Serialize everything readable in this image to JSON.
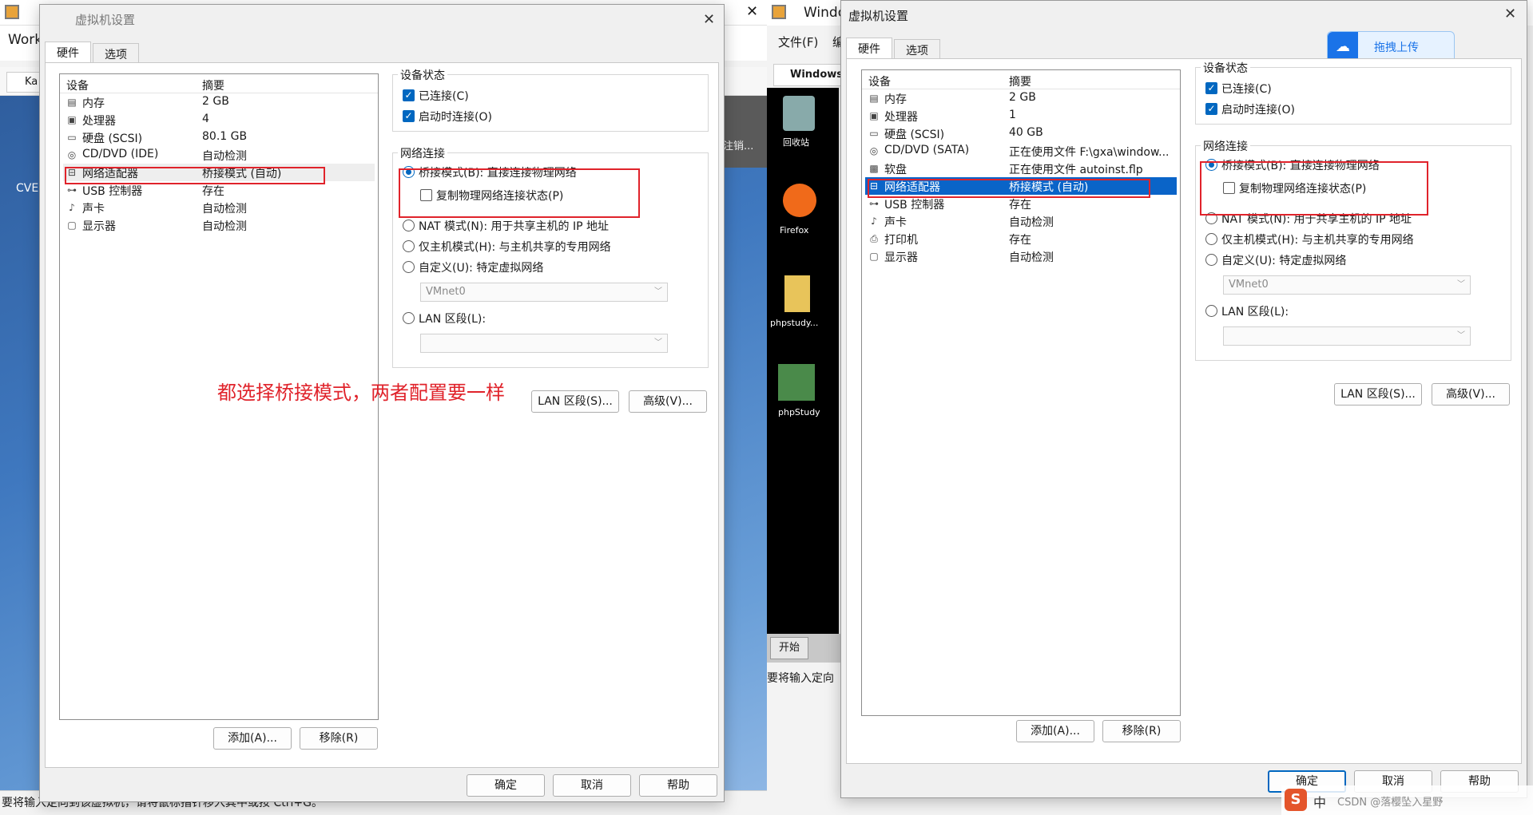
{
  "left_window": {
    "app_title_fragment": "Work",
    "tab_fragment": "Ka",
    "side_text": "CVE",
    "status_text": "要将输入定向到该虚拟机，请将鼠标指针移入其中或按 Ctrl+G。"
  },
  "right_window": {
    "app_title_fragment": "Windo",
    "menu_file": "文件(F)",
    "menu_fragment": "编",
    "tab_fragment": "Windows",
    "desktop_icons": [
      "回收站",
      "Firefox",
      "phpstudy...",
      "phpStudy"
    ],
    "start_button": "开始",
    "status_text": "要将输入定向"
  },
  "left_dialog": {
    "title": "虚拟机设置",
    "tabs": [
      "硬件",
      "选项"
    ],
    "columns": [
      "设备",
      "摘要"
    ],
    "devices": [
      {
        "icon": "memory-icon",
        "name": "内存",
        "summary": "2 GB"
      },
      {
        "icon": "cpu-icon",
        "name": "处理器",
        "summary": "4"
      },
      {
        "icon": "disk-icon",
        "name": "硬盘 (SCSI)",
        "summary": "80.1 GB"
      },
      {
        "icon": "cdrom-icon",
        "name": "CD/DVD (IDE)",
        "summary": "自动检测"
      },
      {
        "icon": "network-icon",
        "name": "网络适配器",
        "summary": "桥接模式 (自动)"
      },
      {
        "icon": "usb-icon",
        "name": "USB 控制器",
        "summary": "存在"
      },
      {
        "icon": "sound-icon",
        "name": "声卡",
        "summary": "自动检测"
      },
      {
        "icon": "display-icon",
        "name": "显示器",
        "summary": "自动检测"
      }
    ],
    "device_status": {
      "label": "设备状态",
      "connected": "已连接(C)",
      "connect_on_power": "启动时连接(O)"
    },
    "network": {
      "label": "网络连接",
      "bridged": "桥接模式(B): 直接连接物理网络",
      "replicate": "复制物理网络连接状态(P)",
      "nat": "NAT 模式(N): 用于共享主机的 IP 地址",
      "host_only": "仅主机模式(H): 与主机共享的专用网络",
      "custom": "自定义(U): 特定虚拟网络",
      "custom_value": "VMnet0",
      "lan": "LAN 区段(L):",
      "lan_value": ""
    },
    "buttons": {
      "lan_segments": "LAN 区段(S)...",
      "advanced": "高级(V)...",
      "add": "添加(A)...",
      "remove": "移除(R)",
      "ok": "确定",
      "cancel": "取消",
      "help": "帮助"
    }
  },
  "right_dialog": {
    "title": "虚拟机设置",
    "tabs": [
      "硬件",
      "选项"
    ],
    "columns": [
      "设备",
      "摘要"
    ],
    "devices": [
      {
        "icon": "memory-icon",
        "name": "内存",
        "summary": "2 GB"
      },
      {
        "icon": "cpu-icon",
        "name": "处理器",
        "summary": "1"
      },
      {
        "icon": "disk-icon",
        "name": "硬盘 (SCSI)",
        "summary": "40 GB"
      },
      {
        "icon": "cdrom-icon",
        "name": "CD/DVD (SATA)",
        "summary": "正在使用文件 F:\\gxa\\window..."
      },
      {
        "icon": "floppy-icon",
        "name": "软盘",
        "summary": "正在使用文件 autoinst.flp"
      },
      {
        "icon": "network-icon",
        "name": "网络适配器",
        "summary": "桥接模式 (自动)"
      },
      {
        "icon": "usb-icon",
        "name": "USB 控制器",
        "summary": "存在"
      },
      {
        "icon": "sound-icon",
        "name": "声卡",
        "summary": "自动检测"
      },
      {
        "icon": "printer-icon",
        "name": "打印机",
        "summary": "存在"
      },
      {
        "icon": "display-icon",
        "name": "显示器",
        "summary": "自动检测"
      }
    ],
    "device_status": {
      "label": "设备状态",
      "connected": "已连接(C)",
      "connect_on_power": "启动时连接(O)"
    },
    "network": {
      "label": "网络连接",
      "bridged": "桥接模式(B): 直接连接物理网络",
      "replicate": "复制物理网络连接状态(P)",
      "nat": "NAT 模式(N): 用于共享主机的 IP 地址",
      "host_only": "仅主机模式(H): 与主机共享的专用网络",
      "custom": "自定义(U): 特定虚拟网络",
      "custom_value": "VMnet0",
      "lan": "LAN 区段(L):",
      "lan_value": ""
    },
    "buttons": {
      "lan_segments": "LAN 区段(S)...",
      "advanced": "高级(V)...",
      "add": "添加(A)...",
      "remove": "移除(R)",
      "ok": "确定",
      "cancel": "取消",
      "help": "帮助"
    }
  },
  "upload_badge": "拖拽上传",
  "annotation": "都选择桥接模式，两者配置要一样",
  "watermark": "CSDN @落樱坠入星野",
  "ime": "中",
  "colors": {
    "accent": "#0067c0",
    "selection": "#0a64c8",
    "annotation_red": "#e0232b"
  }
}
